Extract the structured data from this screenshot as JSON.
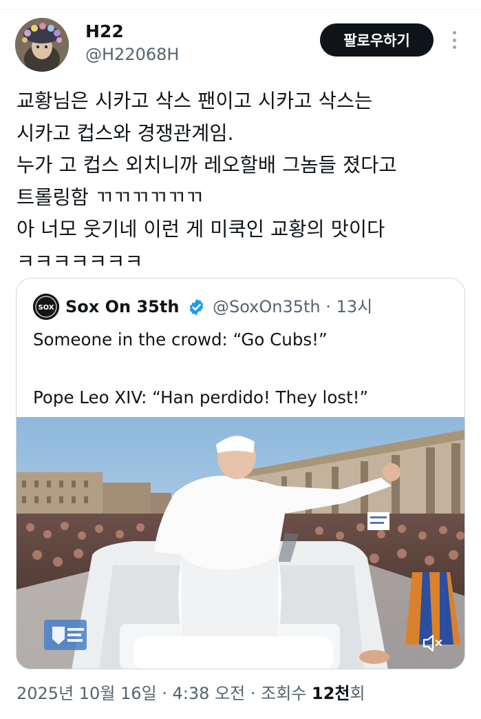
{
  "author": {
    "name": "H22",
    "handle": "@H22068H",
    "follow_label": "팔로우하기"
  },
  "tweet": {
    "lines": [
      "교황님은 시카고 삭스 팬이고 시카고 삭스는",
      "시카고 컵스와 경쟁관계임.",
      "누가 고 컵스 외치니까 레오할배 그놈들 졌다고",
      "트롤링함 ㄲㄲㄲㄲㄲㄲ",
      "아 너모 웃기네 이런 게 미쿡인 교황의 맛이다",
      "ㅋㅋㅋㅋㅋㅋㅋ"
    ]
  },
  "quote": {
    "name": "Sox On 35th",
    "handle": "@SoxOn35th",
    "time": "13시",
    "separator": "·",
    "lines": [
      "Someone in the crowd: “Go Cubs!”",
      "",
      "Pope Leo XIV: “Han perdido! They lost!”"
    ],
    "avatar_text": "SOX"
  },
  "footer": {
    "date": "2025년 10월 16일",
    "sep1": " · ",
    "time": "4:38 오전",
    "sep2": " · ",
    "views_label": "조회수 ",
    "views_count": "12천",
    "views_suffix": "회"
  },
  "colors": {
    "verified": "#1d9bf0",
    "follow_bg": "#0f1419",
    "muted_text": "#536471"
  },
  "icons": [
    "more-vertical-icon",
    "verified-badge-icon",
    "mute-icon",
    "vatican-media-logo"
  ]
}
